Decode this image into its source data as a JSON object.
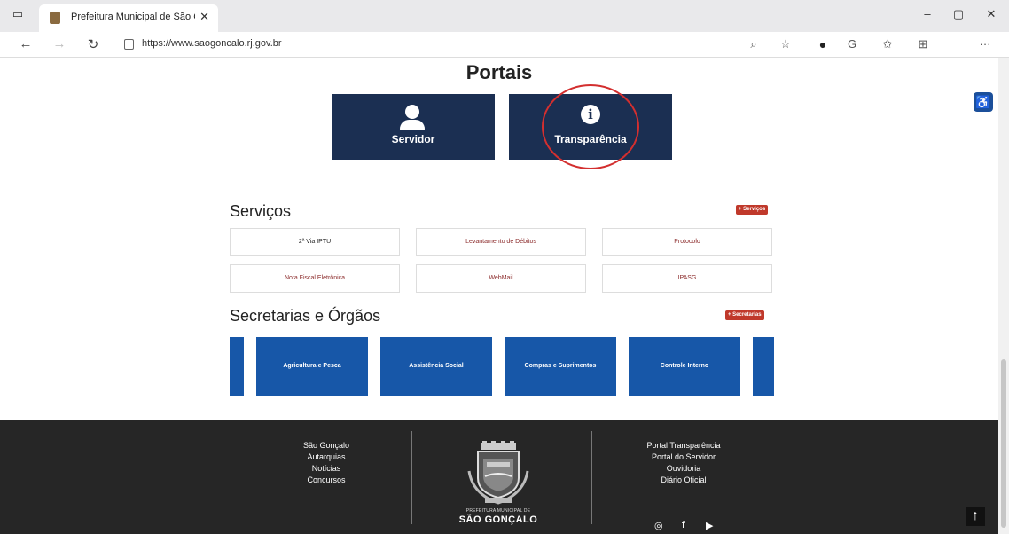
{
  "browser": {
    "tab_title": "Prefeitura Municipal de São Gon",
    "tab_close": "✕",
    "url": "https://www.saogoncalo.rj.gov.br",
    "window_controls": {
      "minimize": "–",
      "maximize": "▢",
      "close": "✕"
    },
    "nav": {
      "back": "←",
      "forward": "→",
      "refresh": "↻"
    },
    "toolbar_icons": [
      "zoom-icon",
      "read-aloud-icon",
      "extension-icon",
      "edge-icon",
      "favorites-icon",
      "collections-icon",
      "more-icon"
    ],
    "more": "···"
  },
  "portais": {
    "title": "Portais",
    "items": [
      {
        "label": "Servidor",
        "icon": "person-icon"
      },
      {
        "label": "Transparência",
        "icon": "info-icon"
      }
    ]
  },
  "servicos": {
    "title": "Serviços",
    "more_label": "+ Serviços",
    "items": [
      "2ª Via IPTU",
      "Levantamento de Débitos",
      "Protocolo",
      "Nota Fiscal Eletrônica",
      "WebMail",
      "IPASG"
    ]
  },
  "secretarias": {
    "title": "Secretarias e Órgãos",
    "more_label": "+ Secretarias",
    "items": [
      "Agricultura e Pesca",
      "Assistência Social",
      "Compras e Suprimentos",
      "Controle Interno"
    ]
  },
  "footer": {
    "col1": [
      "São Gonçalo",
      "Autarquias",
      "Notícias",
      "Concursos"
    ],
    "col2": [
      "Portal Transparência",
      "Portal do Servidor",
      "Ouvidoria",
      "Diário Oficial"
    ],
    "brand_small": "PREFEITURA MUNICIPAL DE",
    "brand_big": "SÃO GONÇALO",
    "social": [
      "◎",
      "f",
      "▶"
    ]
  },
  "colors": {
    "portal_bg": "#1b2f52",
    "secretaria_bg": "#1757a8",
    "badge_red": "#c0392b",
    "footer_bg": "#262626",
    "highlight_red": "#d32f2f"
  }
}
